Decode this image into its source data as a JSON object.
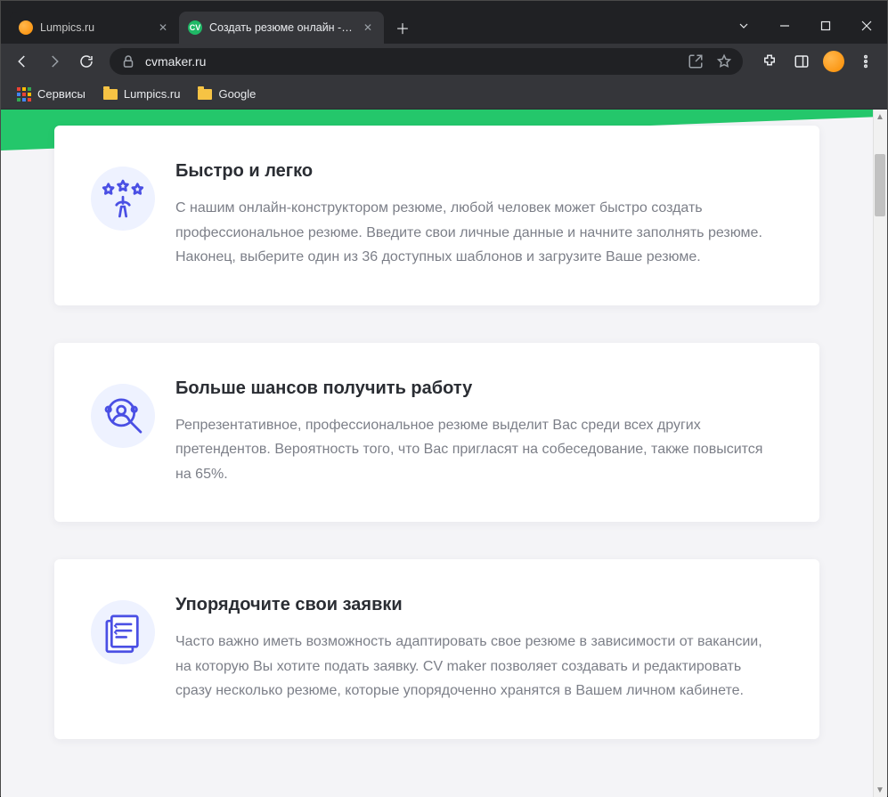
{
  "tabs": [
    {
      "title": "Lumpics.ru",
      "active": false
    },
    {
      "title": "Создать резюме онлайн - конст",
      "active": true
    }
  ],
  "address_bar": {
    "url": "cvmaker.ru"
  },
  "bookmarks": [
    {
      "label": "Сервисы"
    },
    {
      "label": "Lumpics.ru"
    },
    {
      "label": "Google"
    }
  ],
  "cards": [
    {
      "title": "Быстро и легко",
      "body": "С нашим онлайн-конструктором резюме, любой человек может быстро создать профессиональное резюме. Введите свои личные данные и начните заполнять резюме. Наконец, выберите один из 36 доступных шаблонов и загрузите Ваше резюме."
    },
    {
      "title": "Больше шансов получить работу",
      "body": "Репрезентативное, профессиональное резюме выделит Вас среди всех других претендентов. Вероятность того, что Вас пригласят на собеседование, также повысится на 65%."
    },
    {
      "title": "Упорядочите свои заявки",
      "body": "Часто важно иметь возможность адаптировать свое резюме в зависимости от вакансии, на которую Вы хотите подать заявку. CV maker позволяет создавать и редактировать сразу несколько резюме, которые упорядоченно хранятся в Вашем личном кабинете."
    }
  ]
}
